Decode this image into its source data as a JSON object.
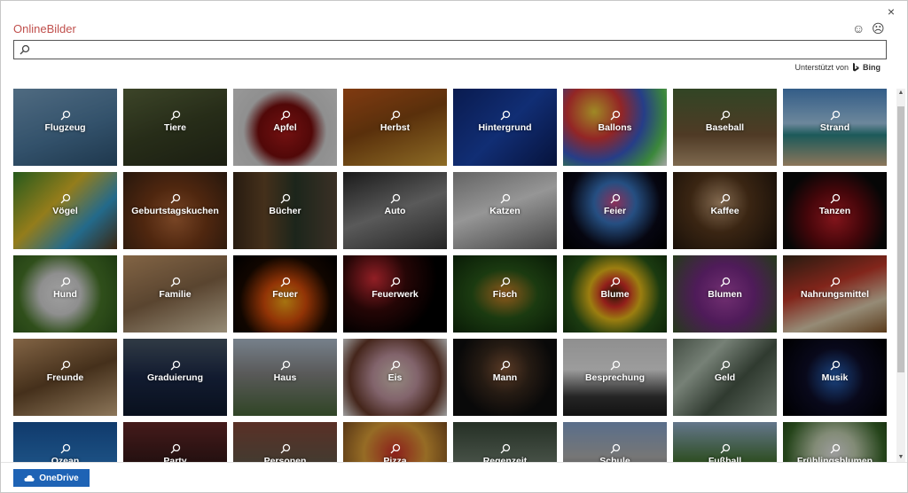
{
  "dialog": {
    "title": "OnlineBilder",
    "close_glyph": "×",
    "smile_glyph": "☺",
    "frown_glyph": "☹"
  },
  "search": {
    "value": "",
    "placeholder": ""
  },
  "powered_by": {
    "prefix": "Unterstützt von",
    "brand": "Bing"
  },
  "tiles": [
    {
      "label": "Flugzeug",
      "bg": "linear-gradient(160deg,#7aa4c6 0%,#4f7ea5 55%,#2f5677 100%)"
    },
    {
      "label": "Tiere",
      "bg": "linear-gradient(160deg,#5d6a3f 0%,#3c4526 50%,#2a2f1c 100%)"
    },
    {
      "label": "Apfel",
      "bg": "radial-gradient(circle at 50% 55%,#b31b1b 0%,#7d0d0d 40%,#dcdcdc 62%,#eaeaea 100%)"
    },
    {
      "label": "Herbst",
      "bg": "linear-gradient(160deg,#c55a1b 0%,#8a4a12 45%,#d9a63a 100%)"
    },
    {
      "label": "Hintergrund",
      "bg": "linear-gradient(135deg,#0f2a7a 0%,#1b47b3 50%,#0a1d5c 100%)"
    },
    {
      "label": "Ballons",
      "bg": "radial-gradient(circle at 30% 30%,#f4d33a 0%,#e23a3a 30%,#3b5fd1 55%,#5bd15b 80%,#ffffff 100%)"
    },
    {
      "label": "Baseball",
      "bg": "linear-gradient(180deg,#4d6b3a 0%,#7a5a3a 60%,#c2a27a 100%)"
    },
    {
      "label": "Strand",
      "bg": "linear-gradient(180deg,#4f8fd1 0%,#a7d0ef 45%,#2b8a8a 60%,#d7b58a 100%)"
    },
    {
      "label": "Vögel",
      "bg": "linear-gradient(135deg,#3b8a2c 0%,#e3c02a 40%,#37a3d6 70%,#5a3a1a 100%)"
    },
    {
      "label": "Geburtstagskuchen",
      "bg": "radial-gradient(circle at 50% 60%,#b96b3a 0%,#7a3c18 45%,#3b2414 100%)"
    },
    {
      "label": "Bücher",
      "bg": "linear-gradient(90deg,#3d2b1a 0%,#6a4a2a 30%,#2c3a2a 60%,#5a4a3a 100%)"
    },
    {
      "label": "Auto",
      "bg": "linear-gradient(160deg,#2a2a2a 0%,#8a8a8a 50%,#3a3a3a 100%)"
    },
    {
      "label": "Katzen",
      "bg": "linear-gradient(160deg,#9a9a9a 0%,#e6e6e6 45%,#6a6a6a 100%)"
    },
    {
      "label": "Feier",
      "bg": "radial-gradient(circle at 50% 40%,#d84a8a 0%,#3a7ac8 30%,#0a0a1a 65%,#000 100%)"
    },
    {
      "label": "Kaffee",
      "bg": "radial-gradient(circle at 45% 40%,#c8a27a 0%,#5a3a1e 40%,#1c120a 100%)"
    },
    {
      "label": "Tanzen",
      "bg": "radial-gradient(circle at 50% 60%,#c8202a 0%,#6a0a10 40%,#0a0a0a 75%)"
    },
    {
      "label": "Hund",
      "bg": "radial-gradient(circle at 45% 50%,#f5f5f5 0%,#dcdcdc 30%,#4a7a2a 60%,#2f5a1c 100%)"
    },
    {
      "label": "Familie",
      "bg": "linear-gradient(160deg,#c89a6a 0%,#8a6a4a 50%,#e6d6b6 100%)"
    },
    {
      "label": "Feuer",
      "bg": "radial-gradient(circle at 50% 60%,#ffb21a 0%,#e0500a 30%,#1a0a00 65%,#000 100%)"
    },
    {
      "label": "Feuerwerk",
      "bg": "radial-gradient(circle at 30% 30%,#e0303a 0%,#3a0a0a 35%,#000 70%)"
    },
    {
      "label": "Fisch",
      "bg": "radial-gradient(ellipse at 50% 50%,#e08a2a 0%,#2a5a1a 45%,#0e2a0a 100%)"
    },
    {
      "label": "Blume",
      "bg": "radial-gradient(circle at 50% 50%,#3a2a0a 0%,#e0302a 20%,#f0c21a 40%,#2a5a1a 70%,#173a0e 100%)"
    },
    {
      "label": "Blumen",
      "bg": "radial-gradient(circle at 50% 50%,#b04ab0 0%,#7a2a8a 45%,#3a5a2a 100%)"
    },
    {
      "label": "Nahrungsmittel",
      "bg": "linear-gradient(160deg,#3a2a1a 0%,#c83a2a 40%,#e6d6b6 70%,#8a5a2a 100%)"
    },
    {
      "label": "Freunde",
      "bg": "linear-gradient(160deg,#c89a6a 0%,#6a4a2a 50%,#d8b68a 100%)"
    },
    {
      "label": "Graduierung",
      "bg": "linear-gradient(180deg,#4a5a6a 0%,#1c2a4a 50%,#0e1a2e 100%)"
    },
    {
      "label": "Haus",
      "bg": "linear-gradient(180deg,#b6c6d6 0%,#8a8a8a 45%,#4a6a3a 100%)"
    },
    {
      "label": "Eis",
      "bg": "radial-gradient(circle at 50% 50%,#e6d6c6 0%,#c89aa6 35%,#6a3a2a 70%,#f0f0f0 100%)"
    },
    {
      "label": "Mann",
      "bg": "radial-gradient(circle at 50% 40%,#8a5a3a 0%,#3a2a1e 35%,#0e0e0e 70%)"
    },
    {
      "label": "Besprechung",
      "bg": "linear-gradient(180deg,#dcdcdc 0%,#f0f0f0 40%,#3a3a3a 75%,#1c1c1c 100%)"
    },
    {
      "label": "Geld",
      "bg": "linear-gradient(135deg,#6a7a6a 0%,#b6c6b6 30%,#4a5a4a 60%,#9aaa9a 100%)"
    },
    {
      "label": "Musik",
      "bg": "radial-gradient(circle at 50% 50%,#2a6ac8 0%,#0e0e2a 45%,#000 100%)"
    },
    {
      "label": "Ozean",
      "bg": "linear-gradient(180deg,#1a5aa6 0%,#2a7ac8 50%,#0e3a7a 100%)"
    },
    {
      "label": "Party",
      "bg": "linear-gradient(180deg,#6a2a2a 0%,#3a1a1a 50%,#8a4a2a 100%)"
    },
    {
      "label": "Personen",
      "bg": "linear-gradient(180deg,#8a4a3a 0%,#6a5a4a 50%,#3a2a2a 100%)"
    },
    {
      "label": "Pizza",
      "bg": "radial-gradient(circle at 50% 40%,#d8302a 0%,#e6a63a 45%,#6a3a1a 100%)"
    },
    {
      "label": "Regenzeit",
      "bg": "linear-gradient(180deg,#3a4a3a 0%,#6a7a6a 50%,#2a3a2a 100%)"
    },
    {
      "label": "Schule",
      "bg": "linear-gradient(180deg,#8aaad6 0%,#b6b6b6 45%,#3a3a3a 100%)"
    },
    {
      "label": "Fußball",
      "bg": "linear-gradient(180deg,#9ab6d6 0%,#4a7a3a 50%,#2f5a1c 100%)"
    },
    {
      "label": "Frühlingsblumen",
      "bg": "radial-gradient(circle at 50% 40%,#f0f0f0 0%,#c8d6b6 30%,#3a6a2a 70%,#1c3a10 100%)"
    }
  ],
  "scrollbar": {
    "up_glyph": "▲",
    "down_glyph": "▼"
  },
  "footer": {
    "onedrive_label": "OneDrive"
  },
  "colors": {
    "title": "#c0504d",
    "onedrive_button": "#1e63b5"
  }
}
